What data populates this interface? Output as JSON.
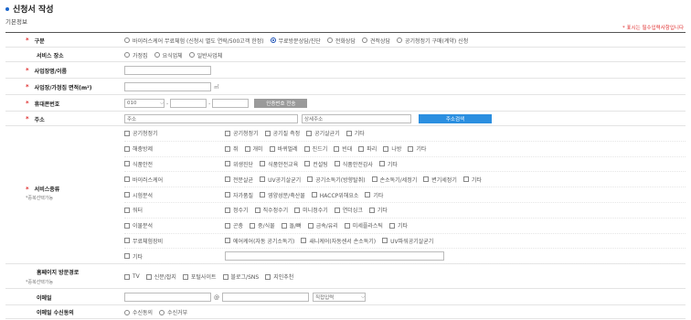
{
  "page": {
    "title": "신청서 작성",
    "subtitle": "기본정보",
    "required_note": "* 표시는 필수입력사항입니다"
  },
  "type_row": {
    "label": "구분",
    "options": [
      {
        "label": "바이러스케어 무료체험 (신청시 별도 연락/500고객 한정)",
        "selected": false
      },
      {
        "label": "무료방문상담/진단",
        "selected": true
      },
      {
        "label": "전화상담",
        "selected": false
      },
      {
        "label": "견적상담",
        "selected": false
      },
      {
        "label": "공기청정기 구매(계약) 신청",
        "selected": false
      }
    ]
  },
  "place_row": {
    "label": "서비스 장소",
    "options": [
      {
        "label": "가정집",
        "selected": false
      },
      {
        "label": "요식업체",
        "selected": false
      },
      {
        "label": "일반사업체",
        "selected": false
      }
    ]
  },
  "name_row": {
    "label": "사업장명/이름",
    "value": ""
  },
  "area_row": {
    "label": "사업장/가정집 면적(m²)",
    "value": "",
    "unit": "㎡"
  },
  "phone_row": {
    "label": "휴대폰번호",
    "prefix": "010",
    "mid": "",
    "last": "",
    "button": "인증번호 전송"
  },
  "address_row": {
    "label": "주소",
    "address_placeholder": "주소",
    "detail_placeholder": "상세주소",
    "button": "주소검색"
  },
  "service_row": {
    "label": "서비스종류",
    "note": "*중복선택가능",
    "categories": [
      {
        "name": "공기청정기",
        "items": [
          "공기청정기",
          "공기질 측정",
          "공기살균기",
          "기타"
        ]
      },
      {
        "name": "해충방제",
        "items": [
          "쥐",
          "개미",
          "바퀴벌레",
          "진드기",
          "빈대",
          "파리",
          "나방",
          "기타"
        ]
      },
      {
        "name": "식품안전",
        "items": [
          "위생진단",
          "식품안전교육",
          "컨설팅",
          "식품안전감사",
          "기타"
        ]
      },
      {
        "name": "바이러스케어",
        "items": [
          "전문살균",
          "UV공기살균기",
          "공기소독기(방향탈취)",
          "손소독기/세정기",
          "변기세정기",
          "기타"
        ]
      },
      {
        "name": "시험분석",
        "items": [
          "자가품질",
          "영양성분/축산물",
          "HACCP위해요소",
          "기타"
        ]
      },
      {
        "name": "워터",
        "items": [
          "정수기",
          "직수정수기",
          "미니정수기",
          "연더싱크",
          "기타"
        ]
      },
      {
        "name": "이물분석",
        "items": [
          "곤충",
          "중/식물",
          "돌/뼈",
          "금속/유리",
          "미세플라스틱",
          "기타"
        ]
      },
      {
        "name": "무료체험장비",
        "items": [
          "에어케어(자동 공기소독기)",
          "새니케어(자동센서 손소독기)",
          "UV파워공기살균기"
        ]
      },
      {
        "name": "기타",
        "items": []
      }
    ]
  },
  "referral_row": {
    "label": "홈페이지 방문경로",
    "note": "*중복선택가능",
    "options": [
      "TV",
      "신문/잡지",
      "포털사이트",
      "블로그/SNS",
      "지인추천"
    ]
  },
  "email_row": {
    "label": "이메일",
    "at": "@",
    "select": "직접입력"
  },
  "consent_row": {
    "label": "이메일 수신동의",
    "options": [
      {
        "label": "수신동의",
        "selected": false
      },
      {
        "label": "수신거부",
        "selected": false
      }
    ]
  },
  "colors": {
    "accent": "#2b8fe0",
    "required": "#e03030",
    "gray_button": "#9a9a9a"
  }
}
